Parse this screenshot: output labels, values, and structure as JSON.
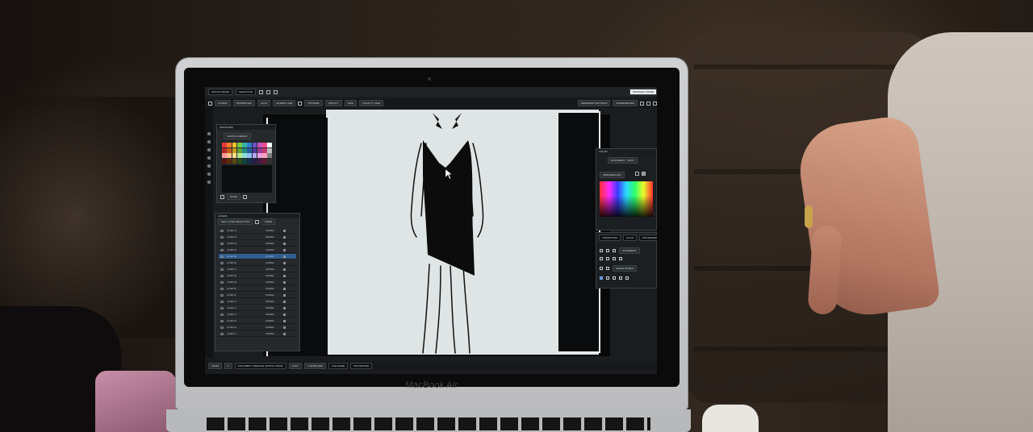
{
  "device": {
    "brand": "MacBook Air"
  },
  "app": {
    "menubar": {
      "left": [
        "SPOON DRAPE",
        "SELECTION"
      ],
      "right": [
        "SNAPSHOT MODE"
      ]
    },
    "toolbar": {
      "items": [
        "LAYERS",
        "PROPERTIES",
        "AUTO",
        "NORMAL LINE",
        "OPTIMIZE",
        "OPACITY",
        "100%",
        "QUALITY: HIGH"
      ],
      "right": [
        "RENDERED SETTINGS",
        "PREFERENCES"
      ]
    },
    "swatches": {
      "title": "SWATCHES",
      "library_label": "SWATCH LIBRARY",
      "mode_label": "MODE",
      "colors": [
        "#e83a3a",
        "#f07a2a",
        "#f3c12a",
        "#7ac943",
        "#2fb5a3",
        "#2f7fd1",
        "#6a4fc9",
        "#c94fbe",
        "#f04f8f",
        "#ffffff",
        "#b52a2a",
        "#c75e1e",
        "#c9a01e",
        "#5ea035",
        "#248c7e",
        "#245fa0",
        "#4f3a9a",
        "#9a3a91",
        "#c23a6d",
        "#bfbfbf",
        "#ff9a9a",
        "#ffc18a",
        "#ffe08a",
        "#b8e68f",
        "#8fe0d4",
        "#8fbff0",
        "#b5a6ef",
        "#ec9fe4",
        "#ff9fc4",
        "#7f7f7f",
        "#5a1414",
        "#5e2c0e",
        "#5e4b0e",
        "#2c4c19",
        "#11423b",
        "#112d4c",
        "#251b49",
        "#491b44",
        "#5c1b33",
        "#303030"
      ]
    },
    "layers": {
      "title": "LAYERS",
      "selector_label": "NEW LAYER SELECTION",
      "mode_label": "MODE",
      "rows": [
        {
          "name": "LAYER 01",
          "blend": "NORMAL"
        },
        {
          "name": "LAYER 02",
          "blend": "NORMAL"
        },
        {
          "name": "LAYER 03",
          "blend": "NORMAL"
        },
        {
          "name": "LAYER 04",
          "blend": "NORMAL"
        },
        {
          "name": "LAYER 05",
          "blend": "NORMAL"
        },
        {
          "name": "LAYER 06",
          "blend": "NORMAL"
        },
        {
          "name": "LAYER 07",
          "blend": "NORMAL"
        },
        {
          "name": "LAYER 08",
          "blend": "NORMAL"
        },
        {
          "name": "LAYER 09",
          "blend": "NORMAL"
        },
        {
          "name": "LAYER 10",
          "blend": "NORMAL"
        },
        {
          "name": "LAYER 11",
          "blend": "NORMAL"
        },
        {
          "name": "LAYER 12",
          "blend": "NORMAL"
        },
        {
          "name": "LAYER 13",
          "blend": "NORMAL"
        },
        {
          "name": "LAYER 14",
          "blend": "NORMAL"
        },
        {
          "name": "LAYER 15",
          "blend": "NORMAL"
        },
        {
          "name": "LAYER 16",
          "blend": "NORMAL"
        },
        {
          "name": "LAYER 17",
          "blend": "NORMAL"
        }
      ],
      "selected_index": 4
    },
    "color": {
      "title": "COLOR",
      "document_label": "DOCUMENT - CMYK",
      "preferences_label": "PREFERENCES"
    },
    "transform": {
      "tabs": [
        "TRANSFORM",
        "ALIGN",
        "PATHFINDER"
      ],
      "alignment_label": "ALIGNMENT",
      "shape_modes_label": "SHAPE MODES"
    },
    "statusbar": {
      "items": [
        "ZOOM",
        "1",
        "DOCUMENT CREATED: EDITING MODE",
        "AUTO",
        "1 ARTBOARD",
        "LIVE MODE",
        "PATHFINDER"
      ]
    }
  }
}
